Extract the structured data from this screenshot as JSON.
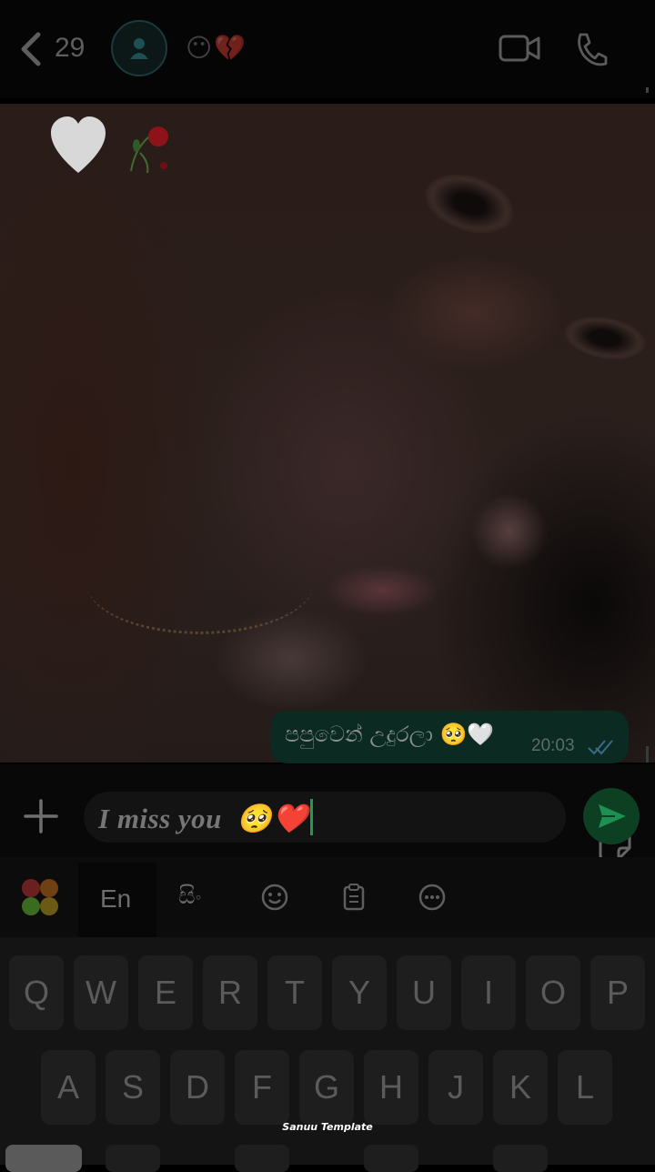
{
  "header": {
    "back_count": "29",
    "status_emoji": "😶💔"
  },
  "message": {
    "text": "පපුවෙන් උදුරලා 🥺🤍",
    "time": "20:03"
  },
  "composer": {
    "input_value": "I miss you  🥺❤️"
  },
  "keyboard_toolbar": {
    "lang_en": "En",
    "lang_si": "සිං"
  },
  "keyboard": {
    "row1": [
      "Q",
      "W",
      "E",
      "R",
      "T",
      "Y",
      "U",
      "I",
      "O",
      "P"
    ],
    "row2": [
      "A",
      "S",
      "D",
      "F",
      "G",
      "H",
      "J",
      "K",
      "L"
    ]
  },
  "watermark": "Sanuu Template",
  "colors": {
    "bubble": "#0a2a22",
    "send_button": "#0d3f22",
    "caret": "#1c9c4c"
  }
}
